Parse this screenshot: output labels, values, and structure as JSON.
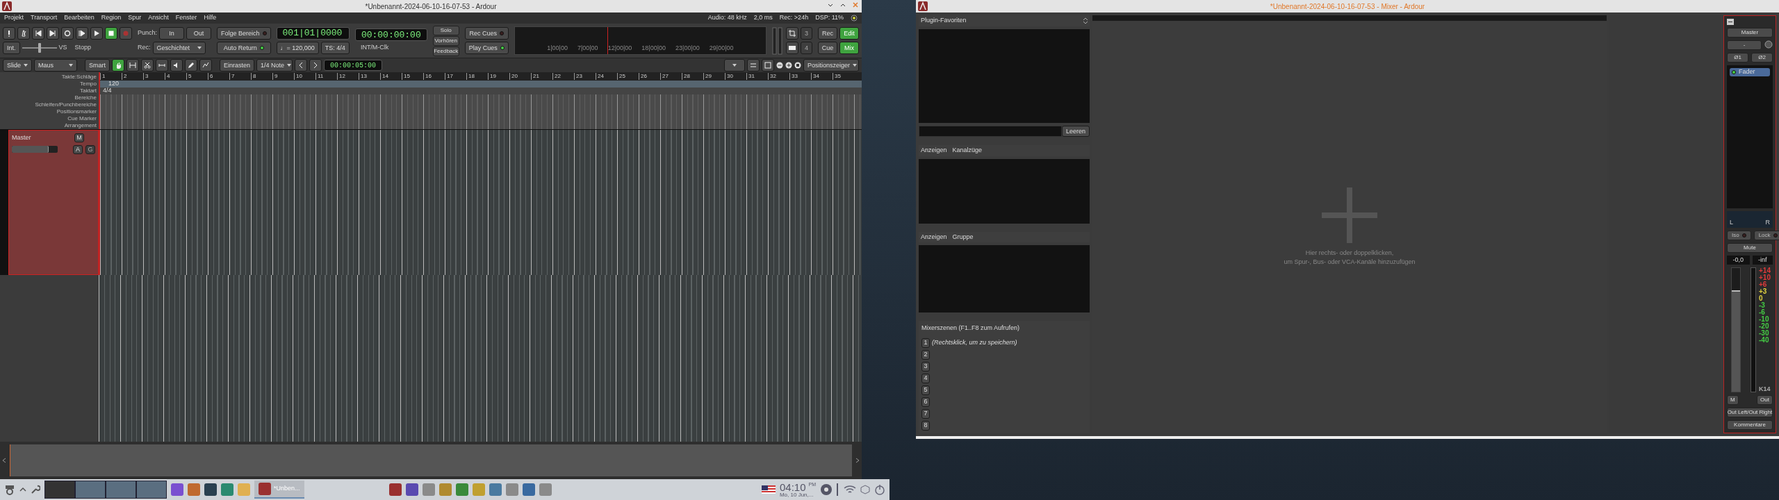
{
  "editor": {
    "title": "*Unbenannt-2024-06-10-16-07-53 - Ardour",
    "menu": [
      "Projekt",
      "Transport",
      "Bearbeiten",
      "Region",
      "Spur",
      "Ansicht",
      "Fenster",
      "Hilfe"
    ],
    "status": [
      "Audio: 48 kHz",
      "2,0 ms",
      "Rec: >24h",
      "DSP: 11%"
    ],
    "transport": {
      "stopped": true,
      "punch_label": "Punch:",
      "punch": [
        {
          "label": "In",
          "on": false
        },
        {
          "label": "Out",
          "on": false
        }
      ],
      "rec_label": "Rec:",
      "rec_mode": "Geschichtet",
      "int": "Int.",
      "shuttle": {
        "level": 0.5
      },
      "vs": "VS",
      "stop_label": "Stopp",
      "follow": {
        "label": "Folge Bereich",
        "on": false
      },
      "auto_return": {
        "label": "Auto Return",
        "on": true
      },
      "clock_primary": "001|01|0000",
      "clock_secondary": "00:00:00:00",
      "tempo": "♩= 120,000",
      "meter": "TS: 4/4",
      "sync": "INT/M-Clk",
      "monitor": [
        "Solo",
        "Vorhören",
        "Feedback"
      ],
      "cues": [
        {
          "label": "Rec Cues",
          "on": false
        },
        {
          "label": "Play Cues",
          "on": true
        }
      ],
      "mini_timeline": [
        "1|00|00",
        "7|00|00",
        "12|00|00",
        "18|00|00",
        "23|00|00",
        "29|00|00"
      ],
      "counters": [
        "3",
        "4"
      ],
      "pages": [
        {
          "label": "Rec",
          "on": false
        },
        {
          "label": "Edit",
          "on": true
        },
        {
          "label": "Cue",
          "on": false
        },
        {
          "label": "Mix",
          "on": true
        }
      ]
    },
    "edit_toolbar": {
      "edit_mode": "Slide",
      "ripple_mode": "Maus",
      "smart": {
        "label": "Smart",
        "on": false
      },
      "tools": [
        {
          "kind": "grab",
          "selected": true
        },
        {
          "kind": "range",
          "selected": false
        },
        {
          "kind": "cut",
          "selected": false
        },
        {
          "kind": "stretch",
          "selected": false
        },
        {
          "kind": "audition",
          "selected": false
        },
        {
          "kind": "draw",
          "selected": false
        },
        {
          "kind": "content",
          "selected": false
        }
      ],
      "snap": "Einrasten",
      "grid": "1/4 Note",
      "nudge_clock": "00:00:05:00",
      "zoom_focus": "Positionszeiger"
    },
    "rulers": [
      "Takte:Schläge",
      "Tempo",
      "Taktart",
      "Bereiche",
      "Schleifen/Punchbereiche",
      "Positionsmarker",
      "Cue Marker",
      "Arrangement"
    ],
    "bars": [
      "1",
      "2",
      "3",
      "4",
      "5",
      "6",
      "7",
      "8",
      "9",
      "10",
      "11",
      "12",
      "13",
      "14",
      "15",
      "16",
      "17",
      "18",
      "19",
      "20",
      "21",
      "22",
      "23",
      "24",
      "25",
      "26",
      "27",
      "28",
      "29",
      "30",
      "31",
      "32",
      "33",
      "34",
      "35"
    ],
    "tempo_marker": "120",
    "meter_marker": "4/4",
    "tracks": [
      {
        "name": "Master",
        "gain": {
          "level": 0.8
        },
        "buttons": [
          {
            "label": "M",
            "disabled": false
          },
          {
            "label": "A",
            "disabled": false
          },
          {
            "label": "G",
            "disabled": true
          }
        ]
      }
    ]
  },
  "mixer": {
    "title": "*Unbenannt-2024-06-10-16-07-53 - Mixer - Ardour",
    "favorites_title": "Plugin-Favoriten",
    "clear": "Leeren",
    "strips_header": [
      "Anzeigen",
      "Kanalzüge"
    ],
    "groups_header": [
      "Anzeigen",
      "Gruppe"
    ],
    "scenes_title": "Mixerszenen (F1..F8 zum Aufrufen)",
    "scenes": [
      {
        "label": "1",
        "hint": "(Rechtsklick, um zu speichern)"
      },
      {
        "label": "2"
      },
      {
        "label": "3"
      },
      {
        "label": "4"
      },
      {
        "label": "5"
      },
      {
        "label": "6"
      },
      {
        "label": "7"
      },
      {
        "label": "8"
      }
    ],
    "hint": [
      "Hier rechts- oder doppelklicken,",
      "um Spur-, Bus- oder VCA-Kanäle hinzuzufügen"
    ],
    "strip": {
      "name": "Master",
      "input": "-",
      "phase": [
        "Ø1",
        "Ø2"
      ],
      "plugins": [
        {
          "name": "Fader",
          "active": true
        }
      ],
      "pan_left": "L",
      "pan_right": "R",
      "iso": {
        "label": "Iso",
        "on": false
      },
      "lock": {
        "label": "Lock",
        "on": false
      },
      "mute": {
        "label": "Mute",
        "on": false
      },
      "gain": "-0,0",
      "peak": "-inf",
      "fader": {
        "level": 0.82
      },
      "scale": [
        {
          "label": "+14",
          "color": "#e03a3a"
        },
        {
          "label": "+10",
          "color": "#e03a3a"
        },
        {
          "label": "+6",
          "color": "#e03a3a"
        },
        {
          "label": "+3",
          "color": "#e0d040"
        },
        {
          "label": "0",
          "color": "#e0d040"
        },
        {
          "label": "-3",
          "color": "#44cc44"
        },
        {
          "label": "-6",
          "color": "#44cc44"
        },
        {
          "label": "-10",
          "color": "#44cc44"
        },
        {
          "label": "-20",
          "color": "#44cc44"
        },
        {
          "label": "-30",
          "color": "#44cc44"
        },
        {
          "label": "-40",
          "color": "#44cc44"
        }
      ],
      "meter_type": "K14",
      "meter_point": "M",
      "output": "Out",
      "routing": "Out Left/Out Right",
      "comments": "Kommentare"
    }
  },
  "taskbar": {
    "window_button": "*Unben...",
    "time": "04:10",
    "ampm": "PM",
    "date": "Mo, 10 Jun,..."
  }
}
